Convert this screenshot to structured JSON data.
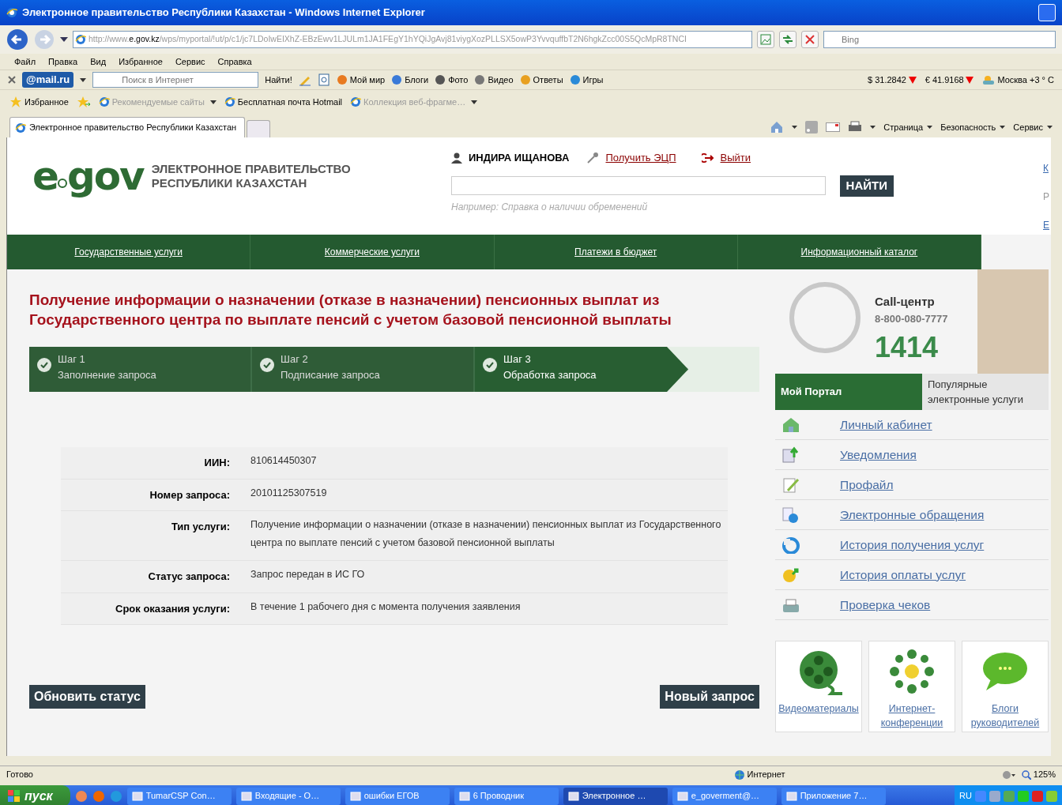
{
  "window": {
    "title": "Электронное правительство Республики Казахстан - Windows Internet Explorer"
  },
  "address_bar": {
    "url_prefix": "http://www.",
    "url_domain": "e.gov.kz",
    "url_rest": "/wps/myportal/!ut/p/c1/jc7LDoIwEIXhZ-EBzEwv1LJULm1JA1FEgY1hYQiJgAvj81viygXozPLLSX5owP3YvvquffbT2N6hgkZcc00S5QcMpR8TNCI",
    "search_placeholder": "Bing"
  },
  "menu": [
    "Файл",
    "Правка",
    "Вид",
    "Избранное",
    "Сервис",
    "Справка"
  ],
  "mail_toolbar": {
    "logo": "@mail.ru",
    "search_placeholder": "Поиск в Интернет",
    "search_button": "Найти!",
    "links": [
      "Мой мир",
      "Блоги",
      "Фото",
      "Видео",
      "Ответы",
      "Игры"
    ],
    "rates": [
      {
        "text": "$ 31.2842",
        "falling": true
      },
      {
        "text": "€ 41.9168",
        "falling": true
      }
    ],
    "weather": "Москва +3 ° C"
  },
  "favorites_bar": {
    "favorites": "Избранное",
    "links": [
      {
        "label": "Рекомендуемые сайты",
        "disabled": true,
        "dropdown": true
      },
      {
        "label": "Бесплатная почта Hotmail",
        "disabled": false,
        "dropdown": false
      },
      {
        "label": "Коллекция веб-фрагме…",
        "disabled": true,
        "dropdown": true
      }
    ]
  },
  "tabs": [
    {
      "label": "Электронное правительство Республики Казахстан",
      "selected": true
    }
  ],
  "command_bar": [
    "Страница",
    "Безопасность",
    "Сервис"
  ],
  "page": {
    "header": {
      "logo_letter": "e",
      "logo_word": "gov",
      "org_lines": [
        "ЭЛЕКТРОННОЕ ПРАВИТЕЛЬСТВО",
        "РЕСПУБЛИКИ КАЗАХСТАН"
      ],
      "user": "ИНДИРА ИЩАНОВА",
      "links": [
        "Получить ЭЦП",
        "Выйти"
      ],
      "search_button": "НАЙТИ",
      "search_hint": "Например: Справка о наличии обременений",
      "edge_links": [
        {
          "text": "К",
          "kind": "link"
        },
        {
          "text": "Р",
          "kind": "text"
        },
        {
          "text": "Е",
          "kind": "link"
        }
      ]
    },
    "nav": [
      "Государственные услуги",
      "Коммерческие услуги",
      "Платежи в бюджет",
      "Информационный каталог"
    ],
    "title": "Получение информации о назначении (отказе в назначении) пенсионных выплат из Государственного центра по выплате пенсий с учетом базовой пенсионной выплаты",
    "steps": [
      {
        "step": "Шаг 1",
        "label": "Заполнение запроса",
        "selected": false
      },
      {
        "step": "Шаг 2",
        "label": "Подписание запроса",
        "selected": false
      },
      {
        "step": "Шаг 3",
        "label": "Обработка запроса",
        "selected": true
      }
    ],
    "details": [
      {
        "label": "ИИН:",
        "value": "810614450307"
      },
      {
        "label": "Номер запроса:",
        "value": "20101125307519"
      },
      {
        "label": "Тип услуги:",
        "value": "Получение информации о назначении (отказе в назначении) пенсионных выплат из Государственного центра по выплате пенсий с учетом базовой пенсионной выплаты"
      },
      {
        "label": "Статус запроса:",
        "value": "Запрос передан в ИС ГО"
      },
      {
        "label": "Срок оказания услуги:",
        "value": "В течение 1 рабочего дня с момента получения заявления"
      }
    ],
    "buttons": [
      "Обновить статус",
      "Новый запрос"
    ],
    "sidebar": {
      "call_center": {
        "title": "Call-центр",
        "phone": "8-800-080-7777",
        "short_number": "1414"
      },
      "tabs": [
        {
          "label": "Мой Портал",
          "selected": true
        },
        {
          "label": "Популярные электронные услуги",
          "selected": false
        }
      ],
      "links": [
        "Личный кабинет",
        "Уведомления",
        "Профайл",
        "Электронные обращения",
        "История получения услуг",
        "История оплаты услуг",
        "Проверка чеков"
      ],
      "tiles": [
        "Видеоматериалы",
        "Интернет-конференции",
        "Блоги руководителей"
      ]
    }
  },
  "status_bar": {
    "text": "Готово",
    "zone": "Интернет",
    "zoom": "125%"
  },
  "taskbar": {
    "start": "пуск",
    "items": [
      {
        "label": "TumarCSP Con…",
        "selected": false
      },
      {
        "label": "Входящие - O…",
        "selected": false
      },
      {
        "label": "ошибки ЕГОВ",
        "selected": false
      },
      {
        "label": "6 Проводник",
        "selected": false
      },
      {
        "label": "Электронное …",
        "selected": true
      },
      {
        "label": "e_goverment@…",
        "selected": false
      },
      {
        "label": "Приложение 7…",
        "selected": false
      }
    ],
    "language": "RU"
  }
}
